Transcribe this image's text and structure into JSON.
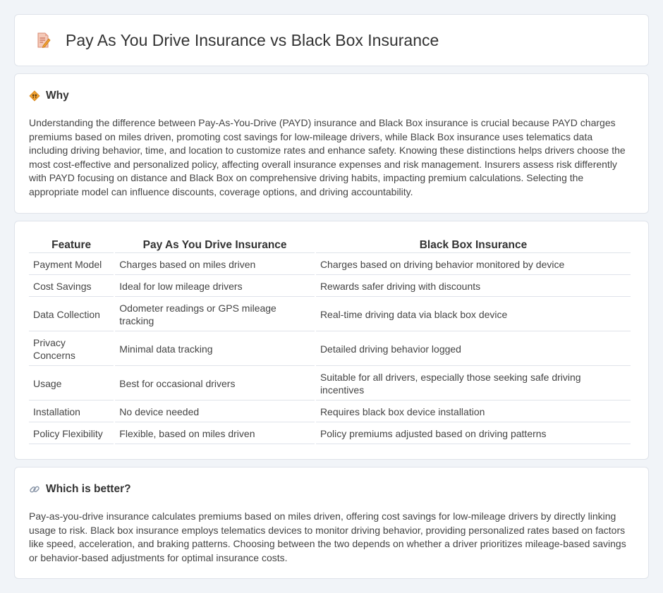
{
  "header": {
    "title": "Pay As You Drive Insurance vs Black Box Insurance",
    "icon": "document-pencil-icon"
  },
  "why": {
    "title": "Why",
    "icon": "warning-sign-icon",
    "text": "Understanding the difference between Pay-As-You-Drive (PAYD) insurance and Black Box insurance is crucial because PAYD charges premiums based on miles driven, promoting cost savings for low-mileage drivers, while Black Box insurance uses telematics data including driving behavior, time, and location to customize rates and enhance safety. Knowing these distinctions helps drivers choose the most cost-effective and personalized policy, affecting overall insurance expenses and risk management. Insurers assess risk differently with PAYD focusing on distance and Black Box on comprehensive driving habits, impacting premium calculations. Selecting the appropriate model can influence discounts, coverage options, and driving accountability."
  },
  "table": {
    "headers": [
      "Feature",
      "Pay As You Drive Insurance",
      "Black Box Insurance"
    ],
    "rows": [
      [
        "Payment Model",
        "Charges based on miles driven",
        "Charges based on driving behavior monitored by device"
      ],
      [
        "Cost Savings",
        "Ideal for low mileage drivers",
        "Rewards safer driving with discounts"
      ],
      [
        "Data Collection",
        "Odometer readings or GPS mileage tracking",
        "Real-time driving data via black box device"
      ],
      [
        "Privacy Concerns",
        "Minimal data tracking",
        "Detailed driving behavior logged"
      ],
      [
        "Usage",
        "Best for occasional drivers",
        "Suitable for all drivers, especially those seeking safe driving incentives"
      ],
      [
        "Installation",
        "No device needed",
        "Requires black box device installation"
      ],
      [
        "Policy Flexibility",
        "Flexible, based on miles driven",
        "Policy premiums adjusted based on driving patterns"
      ]
    ]
  },
  "better": {
    "title": "Which is better?",
    "icon": "link-icon",
    "text": "Pay-as-you-drive insurance calculates premiums based on miles driven, offering cost savings for low-mileage drivers by directly linking usage to risk. Black box insurance employs telematics devices to monitor driving behavior, providing personalized rates based on factors like speed, acceleration, and braking patterns. Choosing between the two depends on whether a driver prioritizes mileage-based savings or behavior-based adjustments for optimal insurance costs."
  },
  "colors": {
    "background": "#f1f4f8",
    "card": "#ffffff",
    "border": "#dfe3ea",
    "warning": "#f0a030"
  }
}
